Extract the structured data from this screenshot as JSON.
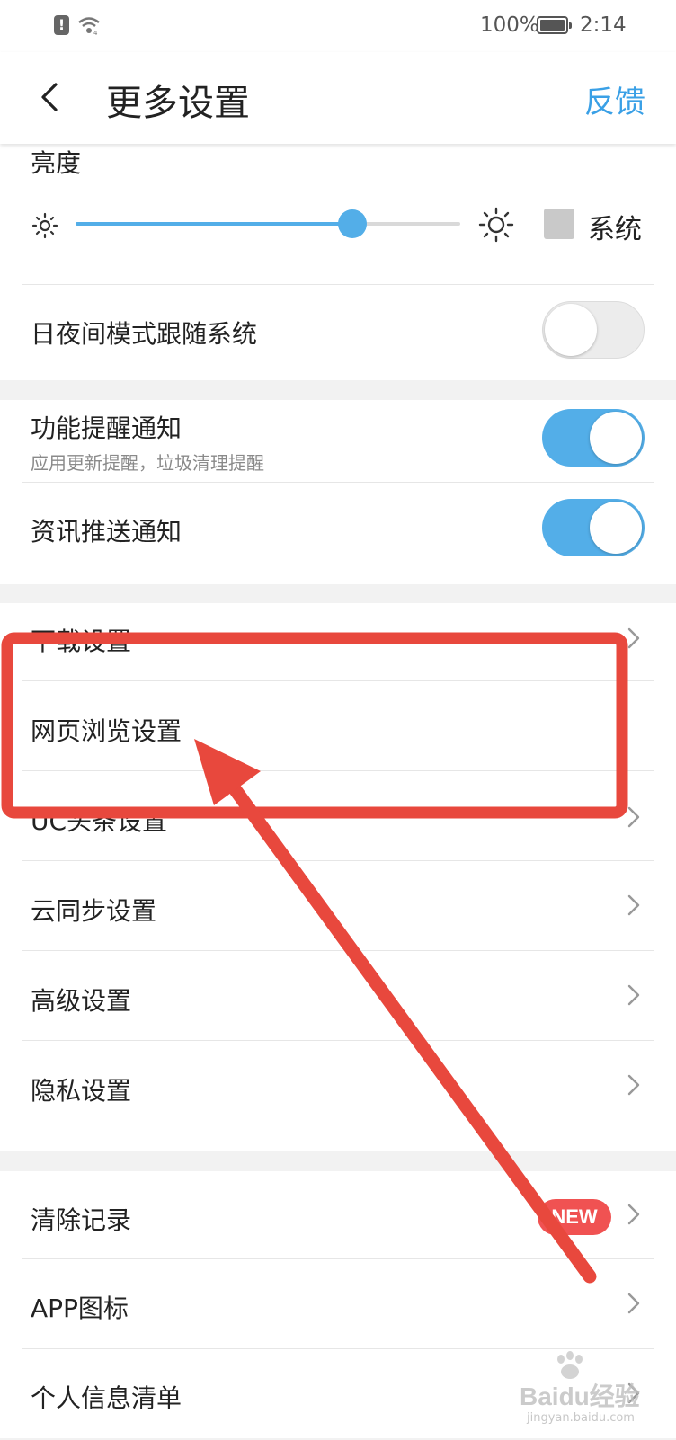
{
  "status_bar": {
    "battery": "100%",
    "time": "2:14"
  },
  "header": {
    "title": "更多设置",
    "feedback": "反馈"
  },
  "brightness": {
    "label": "亮度",
    "level": 0.72,
    "system_label": "系统",
    "system_checked": false
  },
  "day_night": {
    "label": "日夜间模式跟随系统",
    "enabled": false
  },
  "notifications": {
    "feature": {
      "label": "功能提醒通知",
      "sub": "应用更新提醒，垃圾清理提醒",
      "enabled": true
    },
    "news": {
      "label": "资讯推送通知",
      "enabled": true
    }
  },
  "settings_menu": [
    "下载设置",
    "网页浏览设置",
    "UC头条设置",
    "云同步设置",
    "高级设置",
    "隐私设置"
  ],
  "other_menu": {
    "items": [
      "清除记录",
      "APP图标",
      "个人信息清单"
    ],
    "new_badge": "NEW"
  },
  "colors": {
    "accent": "#53aee8",
    "link": "#3aa0e6",
    "badge": "#f05252",
    "annotation": "#e8483d"
  },
  "watermark": {
    "text": "Baidu经验",
    "url": "jingyan.baidu.com"
  }
}
